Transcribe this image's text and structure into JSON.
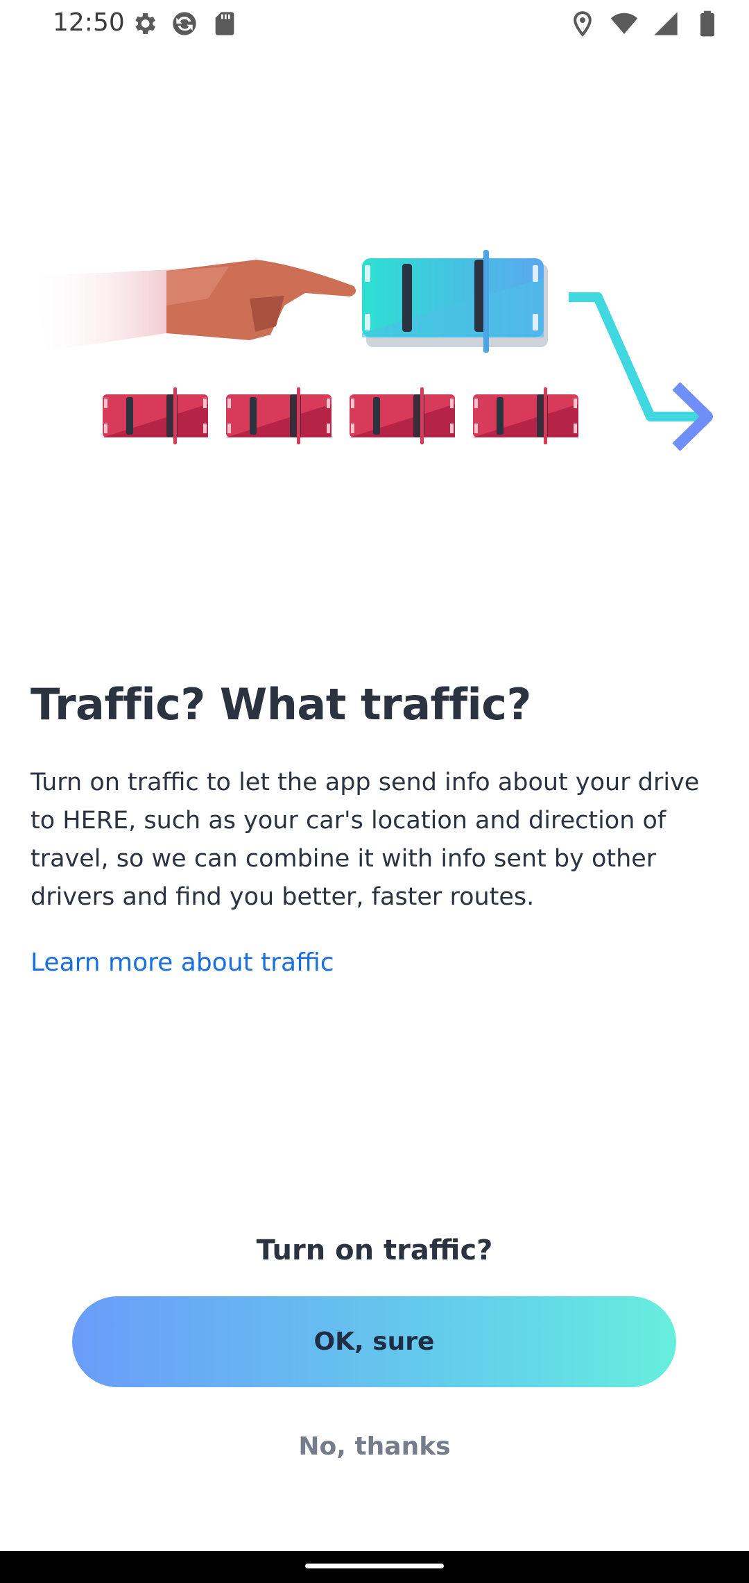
{
  "status_bar": {
    "time": "12:50",
    "left_icons": [
      "settings-icon",
      "sync-icon",
      "sd-card-icon"
    ],
    "right_icons": [
      "location-icon",
      "wifi-icon",
      "cellular-signal-icon",
      "battery-icon"
    ]
  },
  "illustration": {
    "icons": [
      "pointing-hand-icon",
      "car-icon",
      "traffic-cars-icon",
      "route-arrow-icon"
    ],
    "colors": {
      "lead_car": "#36d3dc",
      "traffic_cars": "#d83a5a",
      "route_arrow": "#3fd8e0",
      "arrow_head": "#6f8ef7",
      "hand": "#cc6f55"
    }
  },
  "content": {
    "headline": "Traffic? What traffic?",
    "body": "Turn on traffic to let the app send info about your drive to HERE, such as your car's location and direction of travel, so we can combine it with info sent by other drivers and find you better, faster routes.",
    "learn_more_link": "Learn more about traffic"
  },
  "prompt": {
    "title": "Turn on traffic?",
    "ok_button": "OK, sure",
    "no_button": "No, thanks"
  },
  "colors": {
    "text": "#2b3240",
    "link": "#1a6fe0",
    "secondary_button_text": "#767d8a",
    "primary_gradient_start": "#6a9cf9",
    "primary_gradient_end": "#67eedd"
  }
}
